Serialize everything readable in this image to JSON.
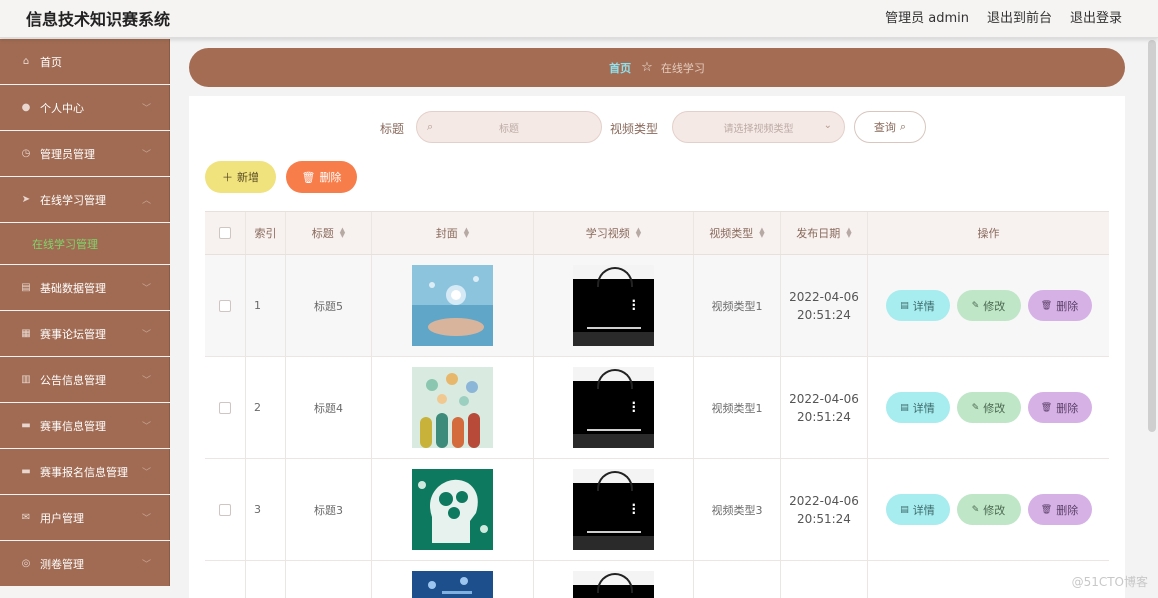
{
  "app": {
    "title": "信息技术知识赛系统"
  },
  "header": {
    "user": "管理员 admin",
    "to_front": "退出到前台",
    "logout": "退出登录"
  },
  "sidebar": {
    "items": [
      {
        "label": "首页",
        "icon": "home-icon"
      },
      {
        "label": "个人中心",
        "icon": "user-icon"
      },
      {
        "label": "管理员管理",
        "icon": "clock-icon"
      },
      {
        "label": "在线学习管理",
        "icon": "send-icon",
        "expanded": true
      },
      {
        "label": "基础数据管理",
        "icon": "clipboard-icon"
      },
      {
        "label": "赛事论坛管理",
        "icon": "grid-icon"
      },
      {
        "label": "公告信息管理",
        "icon": "bar-chart-icon"
      },
      {
        "label": "赛事信息管理",
        "icon": "monitor-icon"
      },
      {
        "label": "赛事报名信息管理",
        "icon": "monitor-icon"
      },
      {
        "label": "用户管理",
        "icon": "mail-icon"
      },
      {
        "label": "测卷管理",
        "icon": "compass-icon"
      }
    ],
    "sub_item": "在线学习管理"
  },
  "breadcrumb": {
    "home": "首页",
    "current": "在线学习"
  },
  "search": {
    "title_label": "标题",
    "title_placeholder": "标题",
    "type_label": "视频类型",
    "type_placeholder": "请选择视频类型",
    "query_button": "查询"
  },
  "actions": {
    "add": "新增",
    "delete": "删除"
  },
  "table": {
    "headers": [
      "索引",
      "标题",
      "封面",
      "学习视频",
      "视频类型",
      "发布日期",
      "操作"
    ],
    "rows": [
      {
        "index": "1",
        "title": "标题5",
        "type": "视频类型1",
        "date": "2022-04-06",
        "time": "20:51:24"
      },
      {
        "index": "2",
        "title": "标题4",
        "type": "视频类型1",
        "date": "2022-04-06",
        "time": "20:51:24"
      },
      {
        "index": "3",
        "title": "标题3",
        "type": "视频类型3",
        "date": "2022-04-06",
        "time": "20:51:24"
      }
    ],
    "row_buttons": {
      "detail": "详情",
      "edit": "修改",
      "delete": "删除"
    }
  },
  "watermark": "@51CTO博客",
  "colors": {
    "brand": "#a16b53",
    "accent_sub": "#7fd66a",
    "add": "#f0e27d",
    "delete": "#f77d4a"
  }
}
